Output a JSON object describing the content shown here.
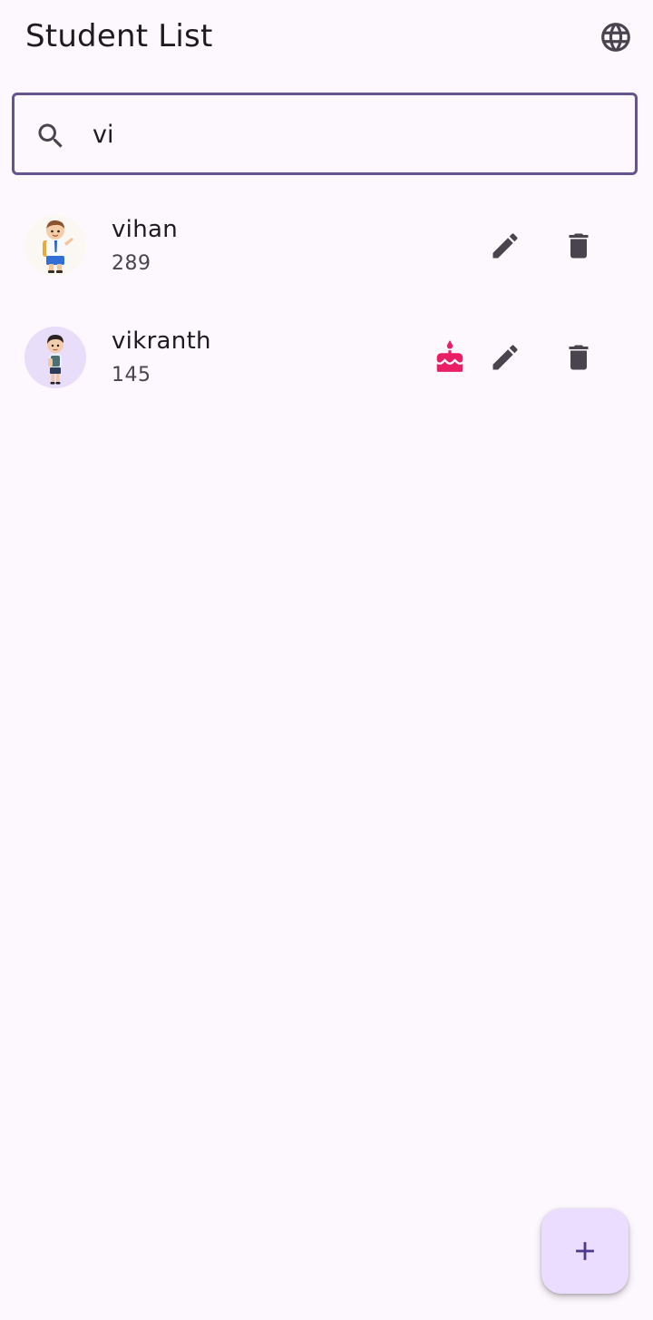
{
  "appbar": {
    "title": "Student List",
    "language_icon": "globe-icon"
  },
  "search": {
    "icon": "search-icon",
    "value": "vi",
    "placeholder": ""
  },
  "students": [
    {
      "name": "vihan",
      "number": "289",
      "avatar": "boy-cartoon-avatar",
      "birthday": false
    },
    {
      "name": "vikranth",
      "number": "145",
      "avatar": "boy-cartoon-avatar",
      "birthday": true
    }
  ],
  "actions": {
    "edit_icon": "pencil-icon",
    "delete_icon": "trash-icon",
    "birthday_icon": "cake-icon",
    "add_icon": "plus-icon"
  },
  "colors": {
    "background": "#fdf7fe",
    "accent": "#65558f",
    "fab": "#eaddff",
    "birthday": "#e91e63",
    "icon": "#49454f"
  }
}
